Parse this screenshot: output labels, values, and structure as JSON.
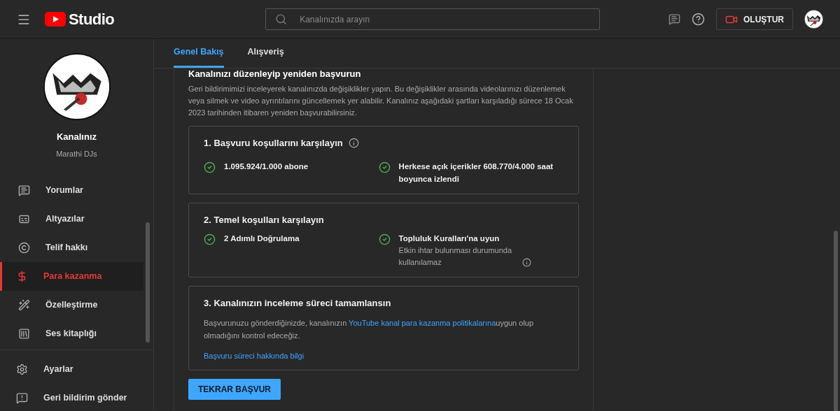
{
  "header": {
    "logo_text": "Studio",
    "search": {
      "placeholder": "Kanalınızda arayın"
    },
    "create_button": "OLUŞTUR"
  },
  "sidebar": {
    "channel_label": "Kanalınız",
    "channel_name": "Marathi DJs",
    "items": [
      {
        "label": "Yorumlar",
        "selected": false
      },
      {
        "label": "Altyazılar",
        "selected": false
      },
      {
        "label": "Telif hakkı",
        "selected": false
      },
      {
        "label": "Para kazanma",
        "selected": true
      },
      {
        "label": "Özelleştirme",
        "selected": false
      },
      {
        "label": "Ses kitaplığı",
        "selected": false
      }
    ],
    "bottom_items": [
      "Ayarlar",
      "Geri bildirim gönder"
    ]
  },
  "tabs": [
    {
      "label": "Genel Bakış",
      "selected": true
    },
    {
      "label": "Alışveriş",
      "selected": false
    }
  ],
  "section": {
    "title": "Kanalınızı düzenleyip yeniden başvurun",
    "description": "Geri bildirimimizi inceleyerek kanalınızda değişiklikler yapın. Bu değişiklikler arasında videolarınızı düzenlemek veya silmek ve video ayrıntılarını güncellemek yer alabilir. Kanalınız aşağıdaki şartları karşıladığı sürece 18 Ocak 2023 tarihinden itibaren yeniden başvurabilirsiniz.",
    "steps": [
      {
        "title": "1. Başvuru koşullarını karşılayın",
        "info": true,
        "criteria": [
          {
            "text": "1.095.924/1.000 abone",
            "met": true
          },
          {
            "text": "Herkese açık içerikler 608.770/4.000 saat boyunca izlendi",
            "met": true
          }
        ]
      },
      {
        "title": "2. Temel koşulları karşılayın",
        "info": false,
        "criteria": [
          {
            "text": "2 Adımlı Doğrulama",
            "met": true
          },
          {
            "text": "Topluluk Kuralları'na uyun",
            "note": "Etkin ihtar bulunması durumunda kullanılamaz",
            "met": true
          }
        ]
      },
      {
        "title": "3. Kanalınızın inceleme süreci tamamlansın",
        "info": false,
        "text_before": "Başvurunuzu gönderdiğinizde, kanalınızın ",
        "link": "YouTube kanal para kazanma politikalarına",
        "text_after": "uygun olup olmadığını kontrol edeceğiz.",
        "more_link": "Başvuru süreci hakkında bilgi"
      }
    ],
    "button": "TEKRAR BAŞVUR"
  }
}
